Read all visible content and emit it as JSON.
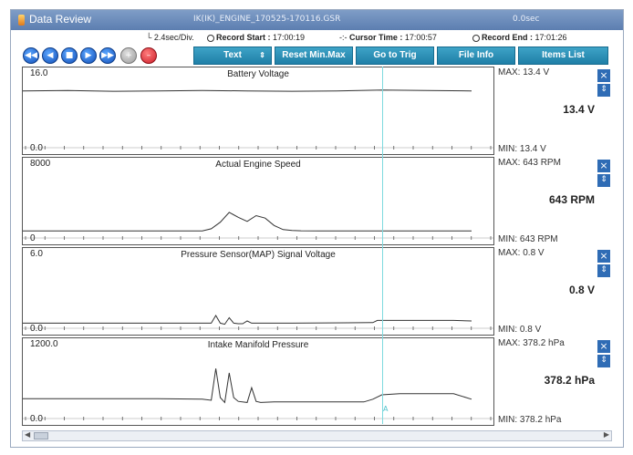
{
  "window": {
    "title": "Data Review",
    "file": "IK(IK)_ENGINE_170525-170116.GSR",
    "elapsed": "0.0sec"
  },
  "info": {
    "time_div": "2.4sec/Div.",
    "record_start_label": "Record Start :",
    "record_start": "17:00:19",
    "cursor_time_label": "Cursor Time :",
    "cursor_time": "17:00:57",
    "record_end_label": "Record End :",
    "record_end": "17:01:26"
  },
  "toolbar": {
    "text_label": "Text",
    "reset_label": "Reset Min.Max",
    "trig_label": "Go to Trig",
    "fileinfo_label": "File Info",
    "items_label": "Items List"
  },
  "cursor_label": "A",
  "colors": {
    "titlebar": "#6a8bbb",
    "button": "#2a8fb8",
    "cursor": "#7dd9df"
  },
  "panels": [
    {
      "name": "Battery Voltage",
      "scale_max": "16.0",
      "scale_min": "0.0",
      "max_text": "MAX:  13.4 V",
      "min_text": "MIN:  13.4 V",
      "current": "13.4 V",
      "ymin": 0,
      "ymax": 16,
      "x": [
        0,
        10,
        20,
        30,
        40,
        50,
        60,
        70,
        80,
        90,
        100
      ],
      "y": [
        13.4,
        13.5,
        13.3,
        13.4,
        13.5,
        13.4,
        13.3,
        13.4,
        13.6,
        13.5,
        13.4
      ]
    },
    {
      "name": "Actual Engine Speed",
      "scale_max": "8000",
      "scale_min": "0",
      "max_text": "MAX:    643 RPM",
      "min_text": "MIN:    643 RPM",
      "current": "643 RPM",
      "ymin": 0,
      "ymax": 8000,
      "x": [
        0,
        40,
        42,
        44,
        46,
        48,
        50,
        52,
        54,
        56,
        58,
        60,
        62,
        66,
        100
      ],
      "y": [
        643,
        650,
        900,
        1700,
        2900,
        2300,
        1800,
        2500,
        2200,
        1300,
        800,
        700,
        660,
        640,
        643
      ]
    },
    {
      "name": "Pressure Sensor(MAP) Signal Voltage",
      "scale_max": "6.0",
      "scale_min": "0.0",
      "max_text": "MAX:   0.8 V",
      "min_text": "MIN:   0.8 V",
      "current": "0.8 V",
      "ymin": 0,
      "ymax": 6,
      "x": [
        0,
        40,
        42,
        43,
        44,
        45,
        46,
        47,
        48,
        49,
        50,
        51,
        52,
        60,
        78,
        79,
        96,
        100
      ],
      "y": [
        0.3,
        0.3,
        0.3,
        1.0,
        0.3,
        0.2,
        0.8,
        0.3,
        0.25,
        0.25,
        0.5,
        0.3,
        0.3,
        0.3,
        0.35,
        0.55,
        0.55,
        0.5
      ]
    },
    {
      "name": "Intake Manifold Pressure",
      "scale_max": "1200.0",
      "scale_min": "0.0",
      "max_text": "MAX: 378.2 hPa",
      "min_text": "MIN: 378.2 hPa",
      "current": "378.2 hPa",
      "ymin": 0,
      "ymax": 1200,
      "x": [
        0,
        30,
        40,
        42,
        43,
        44,
        45,
        46,
        47,
        48,
        50,
        51,
        52,
        53,
        56,
        60,
        70,
        76,
        78,
        80,
        84,
        96,
        100
      ],
      "y": [
        330,
        330,
        320,
        300,
        880,
        350,
        260,
        800,
        350,
        280,
        260,
        530,
        280,
        260,
        270,
        270,
        270,
        270,
        320,
        400,
        420,
        420,
        320
      ]
    }
  ]
}
